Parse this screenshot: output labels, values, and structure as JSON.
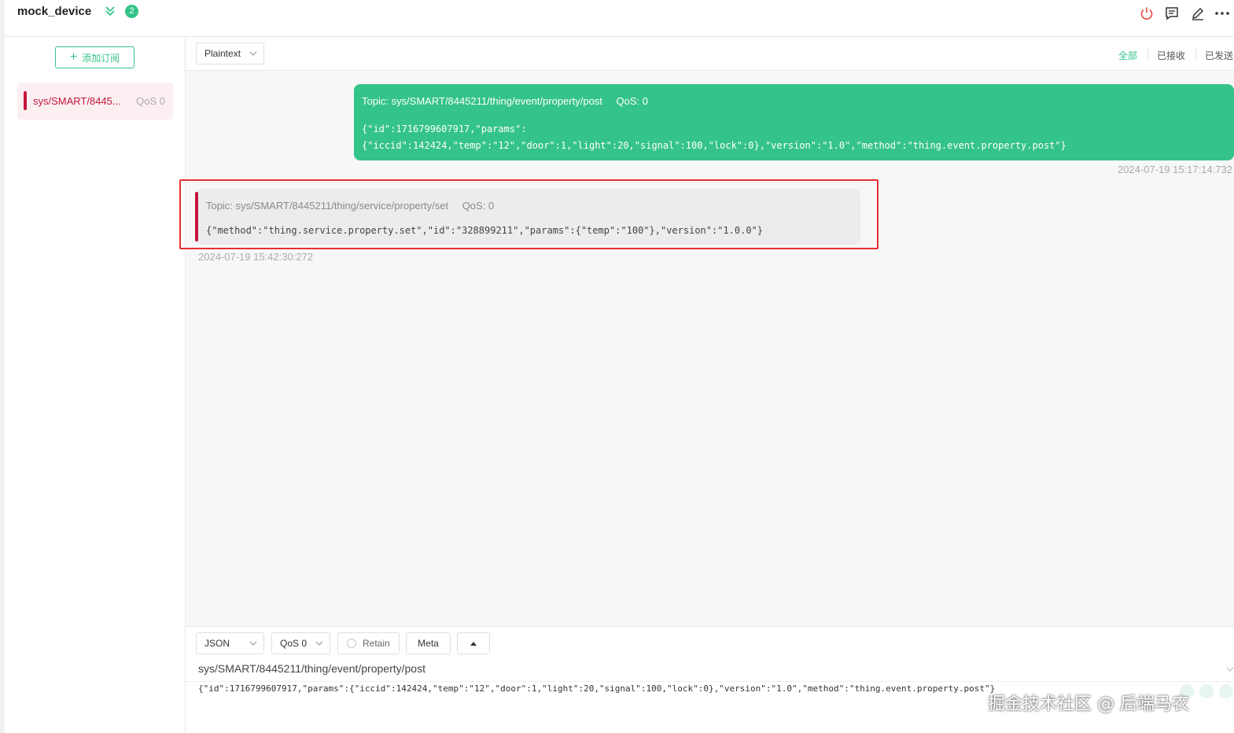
{
  "header": {
    "title": "mock_device",
    "connection_count": "2",
    "icons": [
      "power-icon",
      "chat-icon",
      "edit-icon",
      "more-icon"
    ]
  },
  "sidebar": {
    "add_subscription_label": "添加订阅",
    "subscriptions": [
      {
        "topic": "sys/SMART/8445...",
        "qos": "QoS 0",
        "color": "#c5163c"
      }
    ]
  },
  "toolbar": {
    "payload_format": "Plaintext",
    "filters": [
      "全部",
      "已接收",
      "已发送"
    ],
    "active_filter": "全部"
  },
  "messages": [
    {
      "direction": "sent",
      "topic": "Topic: sys/SMART/8445211/thing/event/property/post",
      "qos": "QoS: 0",
      "payload_line1": "{\"id\":1716799607917,\"params\":",
      "payload_line2": "{\"iccid\":142424,\"temp\":\"12\",\"door\":1,\"light\":20,\"signal\":100,\"lock\":0},\"version\":\"1.0\",\"method\":\"thing.event.property.post\"}",
      "time": "2024-07-19 15:17:14:732"
    },
    {
      "direction": "received",
      "topic": "Topic: sys/SMART/8445211/thing/service/property/set",
      "qos": "QoS: 0",
      "payload": "{\"method\":\"thing.service.property.set\",\"id\":\"328899211\",\"params\":{\"temp\":\"100\"},\"version\":\"1.0.0\"}",
      "time": "2024-07-19 15:42:30:272"
    }
  ],
  "publish": {
    "format": "JSON",
    "qos": "QoS 0",
    "retain_label": "Retain",
    "meta_label": "Meta",
    "topic": "sys/SMART/8445211/thing/event/property/post",
    "payload": "{\"id\":1716799607917,\"params\":{\"iccid\":142424,\"temp\":\"12\",\"door\":1,\"light\":20,\"signal\":100,\"lock\":0},\"version\":\"1.0\",\"method\":\"thing.event.property.post\"}"
  },
  "watermark": "掘金技术社区 @ 后端马农",
  "colors": {
    "accent": "#34c388",
    "received": "#c5163c",
    "highlight": "#e53030"
  }
}
